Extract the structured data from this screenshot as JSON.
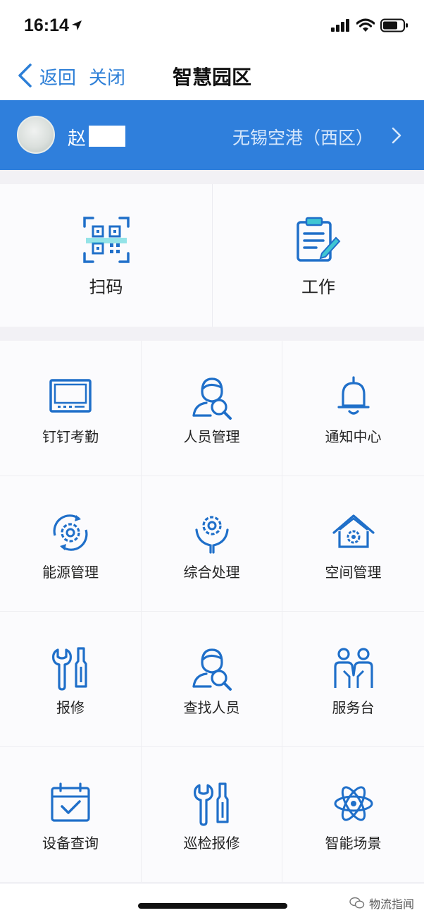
{
  "status_bar": {
    "time": "16:14"
  },
  "nav": {
    "back_label": "返回",
    "close_label": "关闭",
    "title": "智慧园区"
  },
  "user": {
    "name": "赵",
    "location": "无锡空港（西区）"
  },
  "quick_actions": [
    {
      "label": "扫码",
      "icon": "qr-scan-icon"
    },
    {
      "label": "工作",
      "icon": "clipboard-edit-icon"
    }
  ],
  "apps": [
    {
      "label": "钉钉考勤",
      "icon": "monitor-icon"
    },
    {
      "label": "人员管理",
      "icon": "person-search-icon"
    },
    {
      "label": "通知中心",
      "icon": "bell-icon"
    },
    {
      "label": "能源管理",
      "icon": "gear-cycle-icon"
    },
    {
      "label": "综合处理",
      "icon": "gear-hands-icon"
    },
    {
      "label": "空间管理",
      "icon": "house-gear-icon"
    },
    {
      "label": "报修",
      "icon": "wrench-screwdriver-icon"
    },
    {
      "label": "查找人员",
      "icon": "person-search-icon"
    },
    {
      "label": "服务台",
      "icon": "people-icon"
    },
    {
      "label": "设备查询",
      "icon": "calendar-check-icon"
    },
    {
      "label": "巡检报修",
      "icon": "wrench-screwdriver-icon"
    },
    {
      "label": "智能场景",
      "icon": "atom-icon"
    }
  ],
  "watermark": {
    "text": "物流指闻"
  },
  "colors": {
    "accent": "#2f7fdc",
    "icon_blue": "#1f6fc9"
  }
}
